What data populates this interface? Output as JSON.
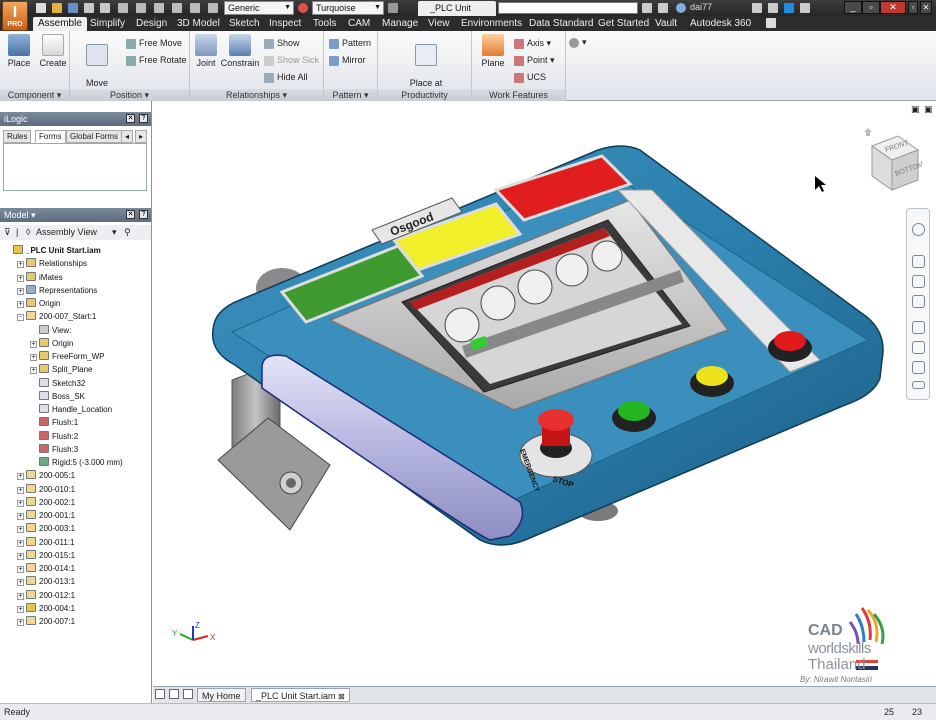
{
  "titlebar": {
    "app_letter": "I",
    "app_sub": "PRO",
    "appearance": "Generic",
    "color_style": "Turquoise",
    "document_title": "_PLC Unit Start....",
    "user": "dai77"
  },
  "tabs": [
    "Assemble",
    "Simplify",
    "Design",
    "3D Model",
    "Sketch",
    "Inspect",
    "Tools",
    "CAM",
    "Manage",
    "View",
    "Environments",
    "Data Standard",
    "Get Started",
    "Vault",
    "Autodesk 360"
  ],
  "active_tab": "Assemble",
  "ribbon": {
    "component": {
      "label": "Component",
      "place": "Place",
      "create": "Create"
    },
    "position": {
      "label": "Position",
      "move_component": "Move\nComponent",
      "free_move": "Free Move",
      "free_rotate": "Free Rotate"
    },
    "relationships": {
      "label": "Relationships",
      "joint": "Joint",
      "constrain": "Constrain",
      "show": "Show",
      "show_sick": "Show Sick",
      "hide_all": "Hide All"
    },
    "pattern": {
      "label": "Pattern",
      "pattern": "Pattern",
      "mirror": "Mirror"
    },
    "productivity": {
      "label": "Productivity",
      "place_at_origin": "Place at\nComponent Origin"
    },
    "work_features": {
      "label": "Work Features",
      "plane": "Plane",
      "axis": "Axis",
      "point": "Point",
      "ucs": "UCS"
    }
  },
  "ilogic": {
    "title": "iLogic",
    "tabs": [
      "Rules",
      "Forms",
      "Global Forms"
    ],
    "active_tab": "Forms"
  },
  "model": {
    "title": "Model",
    "view": "Assembly View",
    "tree": [
      {
        "label": "_PLC Unit Start.iam",
        "level": 0,
        "icon": "assembly-icon",
        "exp": ""
      },
      {
        "label": "Relationships",
        "level": 1,
        "icon": "folder-icon",
        "exp": "+"
      },
      {
        "label": "iMates",
        "level": 1,
        "icon": "folder-icon",
        "exp": "+"
      },
      {
        "label": "Representations",
        "level": 1,
        "icon": "representations-icon",
        "exp": "+"
      },
      {
        "label": "Origin",
        "level": 1,
        "icon": "folder-icon",
        "exp": "+"
      },
      {
        "label": "200-007_Start:1",
        "level": 1,
        "icon": "part-icon",
        "exp": "-"
      },
      {
        "label": "View:",
        "level": 2,
        "icon": "view-icon",
        "exp": ""
      },
      {
        "label": "Origin",
        "level": 2,
        "icon": "folder-icon",
        "exp": "+"
      },
      {
        "label": "FreeForm_WP",
        "level": 2,
        "icon": "freeform-icon",
        "exp": "+"
      },
      {
        "label": "Split_Plane",
        "level": 2,
        "icon": "split-icon",
        "exp": "+"
      },
      {
        "label": "Sketch32",
        "level": 2,
        "icon": "sketch-icon",
        "exp": ""
      },
      {
        "label": "Boss_SK",
        "level": 2,
        "icon": "sketch-icon",
        "exp": ""
      },
      {
        "label": "Handle_Location",
        "level": 2,
        "icon": "sketch-icon",
        "exp": ""
      },
      {
        "label": "Flush:1",
        "level": 2,
        "icon": "flush-icon",
        "exp": ""
      },
      {
        "label": "Flush:2",
        "level": 2,
        "icon": "flush-icon",
        "exp": ""
      },
      {
        "label": "Flush:3",
        "level": 2,
        "icon": "flush-icon",
        "exp": ""
      },
      {
        "label": "Rigid:5 (-3.000 mm)",
        "level": 2,
        "icon": "rigid-icon",
        "exp": ""
      },
      {
        "label": "200-005:1",
        "level": 1,
        "icon": "part-icon",
        "exp": "+"
      },
      {
        "label": "200-010:1",
        "level": 1,
        "icon": "part-icon",
        "exp": "+"
      },
      {
        "label": "200-002:1",
        "level": 1,
        "icon": "part-icon",
        "exp": "+"
      },
      {
        "label": "200-001:1",
        "level": 1,
        "icon": "part-icon",
        "exp": "+"
      },
      {
        "label": "200-003:1",
        "level": 1,
        "icon": "part-icon",
        "exp": "+"
      },
      {
        "label": "200-011:1",
        "level": 1,
        "icon": "part-icon",
        "exp": "+"
      },
      {
        "label": "200-015:1",
        "level": 1,
        "icon": "part-icon",
        "exp": "+"
      },
      {
        "label": "200-014:1",
        "level": 1,
        "icon": "part-icon",
        "exp": "+"
      },
      {
        "label": "200-013:1",
        "level": 1,
        "icon": "part-icon",
        "exp": "+"
      },
      {
        "label": "200-012:1",
        "level": 1,
        "icon": "part-icon",
        "exp": "+"
      },
      {
        "label": "200-004:1",
        "level": 1,
        "icon": "assembly-icon",
        "exp": "+"
      },
      {
        "label": "200-007:1",
        "level": 1,
        "icon": "part-icon",
        "exp": "+"
      }
    ]
  },
  "canvas": {
    "device_brand": "Osgood",
    "stop_label": "STOP",
    "emergency_label": "EMERGENCY",
    "viewcube_front": "FRONT",
    "viewcube_bottom": "BOTTOM",
    "triad": {
      "x": "X",
      "y": "Y",
      "z": "Z"
    }
  },
  "watermark": {
    "cad": "CAD",
    "worldskills": "worldskills",
    "thailand": "Thailand",
    "by": "By: Nirawit Nontasiri"
  },
  "doc_tabs": [
    "My Home",
    "_PLC Unit Start.iam"
  ],
  "status": {
    "text": "Ready",
    "count_a": "25",
    "count_b": "23"
  }
}
